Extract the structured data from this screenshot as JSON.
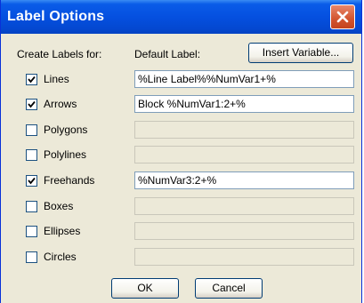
{
  "dialog": {
    "title": "Label Options"
  },
  "header": {
    "create_label": "Create Labels for:",
    "default_label": "Default Label:",
    "insert_variable": "Insert Variable..."
  },
  "rows": [
    {
      "label": "Lines",
      "checked": true,
      "value": "%Line Label%%NumVar1+%"
    },
    {
      "label": "Arrows",
      "checked": true,
      "value": "Block %NumVar1:2+%"
    },
    {
      "label": "Polygons",
      "checked": false,
      "value": ""
    },
    {
      "label": "Polylines",
      "checked": false,
      "value": ""
    },
    {
      "label": "Freehands",
      "checked": true,
      "value": "%NumVar3:2+%"
    },
    {
      "label": "Boxes",
      "checked": false,
      "value": ""
    },
    {
      "label": "Ellipses",
      "checked": false,
      "value": ""
    },
    {
      "label": "Circles",
      "checked": false,
      "value": ""
    }
  ],
  "buttons": {
    "ok": "OK",
    "cancel": "Cancel"
  },
  "icons": {
    "close": "close-icon",
    "check": "check-icon"
  }
}
